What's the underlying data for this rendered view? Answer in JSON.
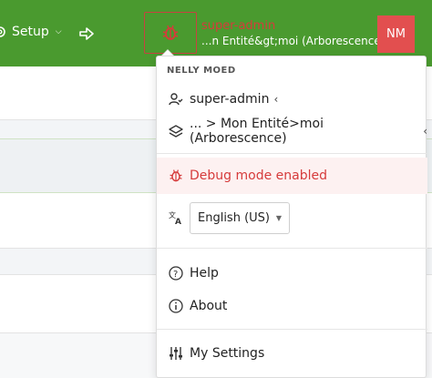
{
  "topbar": {
    "setup_label": "Setup",
    "user_name": "super-admin",
    "user_entity": "...n Entité&gt;moi (Arborescence)",
    "avatar_initials": "NM"
  },
  "dropdown": {
    "header": "NELLY MOED",
    "user_label": "super-admin",
    "user_chevron": "‹",
    "entity_label": "... > Mon Entité>moi (Arborescence)",
    "entity_chevron": "‹",
    "debug_label": "Debug mode enabled",
    "language_value": "English (US)",
    "help_label": "Help",
    "about_label": "About",
    "settings_label": "My Settings"
  },
  "colors": {
    "topbar": "#4a9a2f",
    "debug_red": "#d63b3b",
    "avatar": "#e24f4f"
  }
}
